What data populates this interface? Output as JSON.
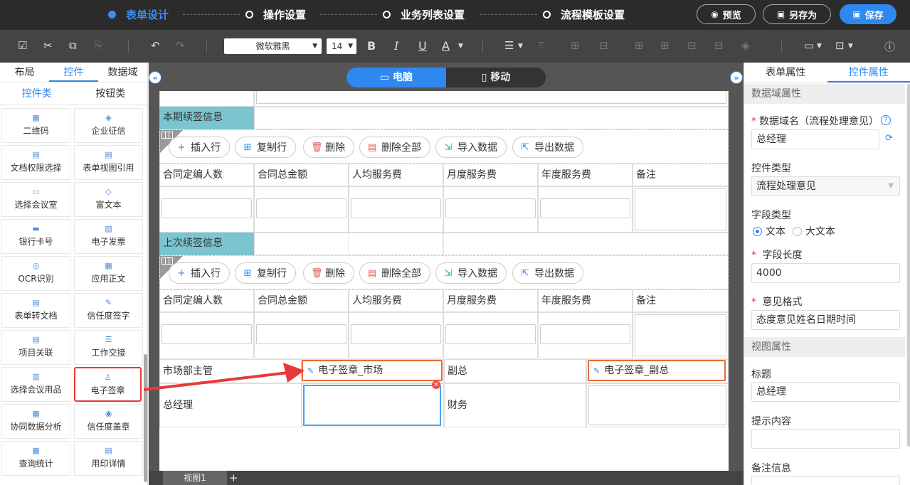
{
  "topbar": {
    "steps": [
      "表单设计",
      "操作设置",
      "业务列表设置",
      "流程模板设置"
    ],
    "buttons": {
      "preview": "预览",
      "save_as": "另存为",
      "save": "保存"
    }
  },
  "toolbar": {
    "font": "微软雅黑",
    "size": "14",
    "bold": "B",
    "italic": "I",
    "underline": "U",
    "font_color": "A"
  },
  "left": {
    "tabs": [
      "布局",
      "控件",
      "数据域"
    ],
    "subtabs": [
      "控件类",
      "按钮类"
    ],
    "components": [
      "二维码",
      "企业征信",
      "文档权限选择",
      "表单视图引用",
      "选择会议室",
      "富文本",
      "银行卡号",
      "电子发票",
      "OCR识别",
      "应用正文",
      "表单转文档",
      "信任度签字",
      "项目关联",
      "工作交接",
      "选择会议用品",
      "电子签章",
      "协同数据分析",
      "信任度盖章",
      "查询统计",
      "用印详情"
    ]
  },
  "center": {
    "device": {
      "pc": "电脑",
      "mobile": "移动"
    },
    "section1": "本期续签信息",
    "section2": "上次续签信息",
    "ops": [
      "插入行",
      "复制行",
      "删除",
      "删除全部",
      "导入数据",
      "导出数据"
    ],
    "columns": [
      "合同定编人数",
      "合同总金额",
      "人均服务费",
      "月度服务费",
      "年度服务费",
      "备注"
    ],
    "sig": {
      "market_label": "市场部主管",
      "market_field": "电子签章_市场",
      "vp_label": "副总",
      "vp_field": "电子签章_副总",
      "gm_label": "总经理",
      "finance_label": "财务"
    },
    "view_tab": "视图1",
    "view_add": "+"
  },
  "right": {
    "tabs": [
      "表单属性",
      "控件属性"
    ],
    "data_head": "数据域属性",
    "field_name_label": "数据域名（流程处理意见）",
    "field_name_value": "总经理",
    "control_type_label": "控件类型",
    "control_type_value": "流程处理意见",
    "field_type_label": "字段类型",
    "field_type_opt1": "文本",
    "field_type_opt2": "大文本",
    "length_label": "字段长度",
    "length_value": "4000",
    "format_label": "意见格式",
    "format_value": "态度意见姓名日期时间",
    "view_head": "视图属性",
    "title_label": "标题",
    "title_value": "总经理",
    "hint_label": "提示内容",
    "note_label": "备注信息"
  }
}
